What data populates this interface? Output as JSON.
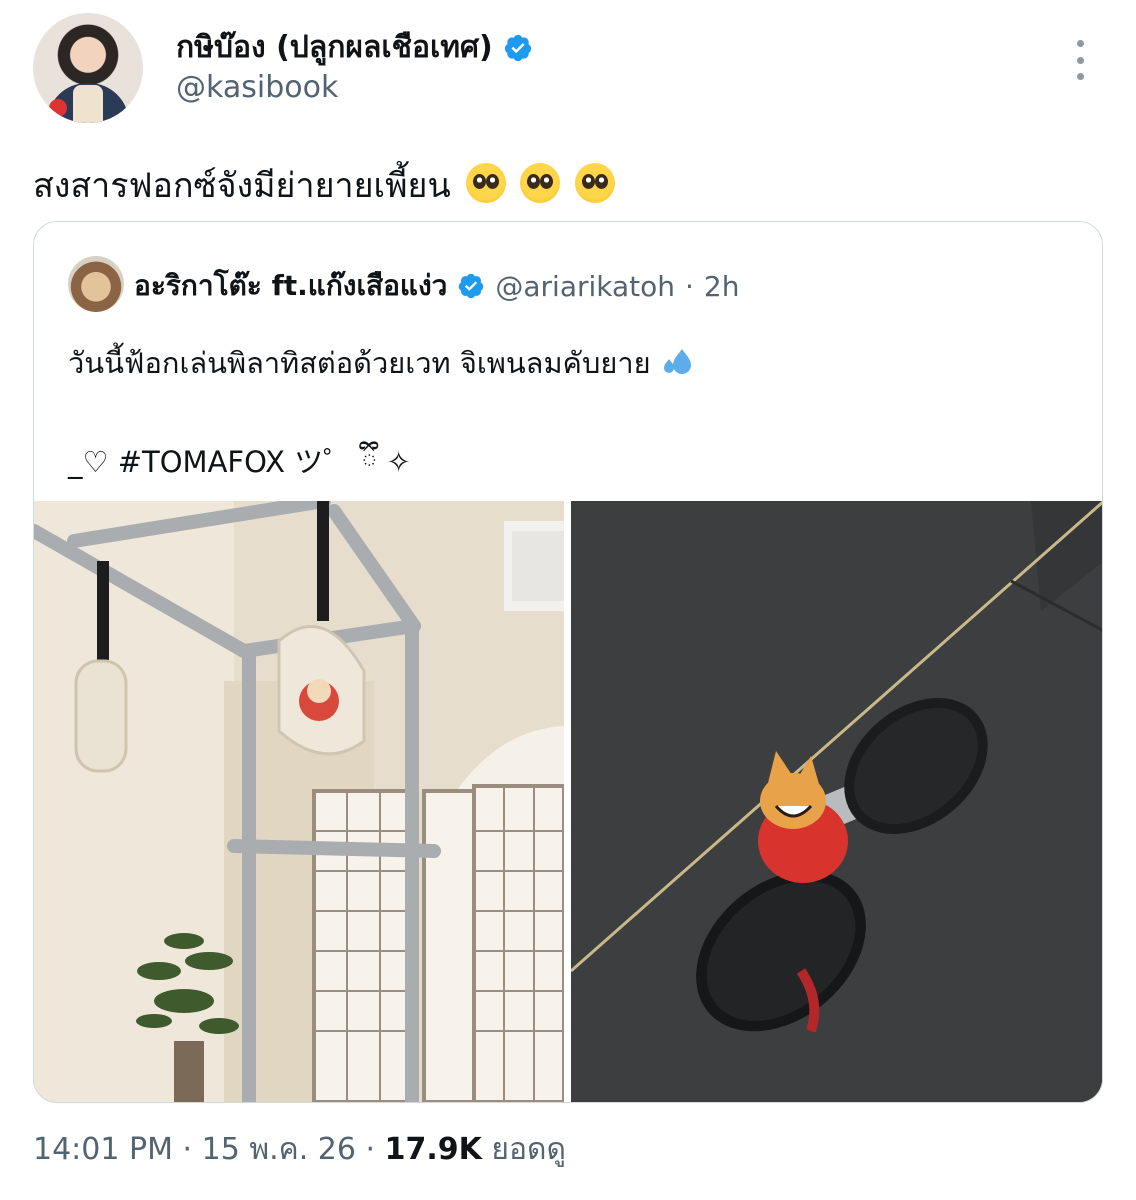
{
  "author": {
    "display_name": "กษิบ๊อง (ปลูกผลเชือเทศ)",
    "handle": "@kasibook",
    "verified": true
  },
  "tweet": {
    "text": "สงสารฟอกซ์จังมีย่ายายเพี้ยน",
    "emojis": [
      "pleading-face-emoji",
      "pleading-face-emoji",
      "pleading-face-emoji"
    ]
  },
  "quoted": {
    "display_name": "อะริกาโต๊ะ ft.แก๊งเสือแง่ว",
    "handle": "@ariarikatoh",
    "separator": "·",
    "age": "2h",
    "text_line1": "วันนี้ฟ้อกเล่นพิลาทิสต่อด้วยเวท จิเพนลมคับยาย",
    "text_line2": "_♡ #TOMAFOX ツ゜ ྀི ✧",
    "photos": [
      {
        "name": "pilates-frame-photo"
      },
      {
        "name": "dumbbell-photo"
      }
    ]
  },
  "meta": {
    "time": "14:01 PM",
    "sep1": "·",
    "date": "15 พ.ค. 26",
    "sep2": "·",
    "views": "17.9K",
    "views_label": "ยอดดู"
  },
  "colors": {
    "verified": "#1d9bf0",
    "secondary_text": "#536471",
    "border": "#cfd9de"
  }
}
